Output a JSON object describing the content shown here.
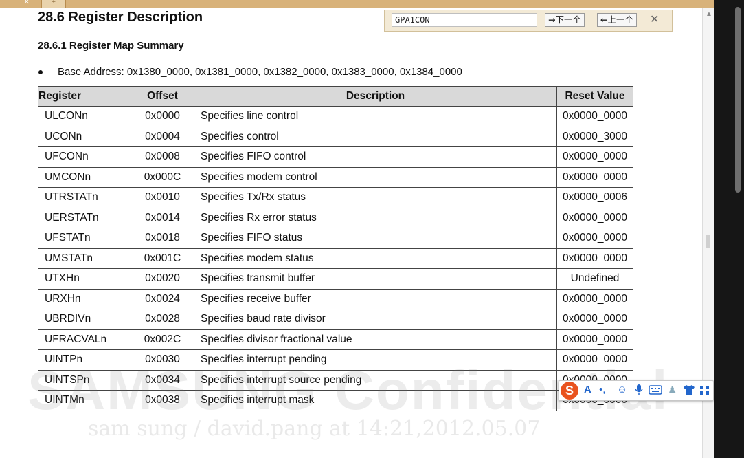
{
  "tabs": {
    "close": "✕",
    "new": "+"
  },
  "heading": "28.6 Register Description",
  "subheading": "28.6.1 Register Map Summary",
  "base_address": "Base Address: 0x1380_0000, 0x1381_0000, 0x1382_0000, 0x1383_0000, 0x1384_0000",
  "table": {
    "headers": [
      "Register",
      "Offset",
      "Description",
      "Reset Value"
    ],
    "rows": [
      [
        "ULCONn",
        "0x0000",
        "Specifies line control",
        "0x0000_0000"
      ],
      [
        "UCONn",
        "0x0004",
        "Specifies control",
        "0x0000_3000"
      ],
      [
        "UFCONn",
        "0x0008",
        "Specifies FIFO control",
        "0x0000_0000"
      ],
      [
        "UMCONn",
        "0x000C",
        "Specifies modem control",
        "0x0000_0000"
      ],
      [
        "UTRSTATn",
        "0x0010",
        "Specifies Tx/Rx status",
        "0x0000_0006"
      ],
      [
        "UERSTATn",
        "0x0014",
        "Specifies Rx error status",
        "0x0000_0000"
      ],
      [
        "UFSTATn",
        "0x0018",
        "Specifies FIFO status",
        "0x0000_0000"
      ],
      [
        "UMSTATn",
        "0x001C",
        "Specifies modem status",
        "0x0000_0000"
      ],
      [
        "UTXHn",
        "0x0020",
        "Specifies transmit buffer",
        "Undefined"
      ],
      [
        "URXHn",
        "0x0024",
        "Specifies receive buffer",
        "0x0000_0000"
      ],
      [
        "UBRDIVn",
        "0x0028",
        "Specifies baud rate divisor",
        "0x0000_0000"
      ],
      [
        "UFRACVALn",
        "0x002C",
        "Specifies divisor fractional value",
        "0x0000_0000"
      ],
      [
        "UINTPn",
        "0x0030",
        "Specifies interrupt pending",
        "0x0000_0000"
      ],
      [
        "UINTSPn",
        "0x0034",
        "Specifies interrupt source pending",
        "0x0000_0000"
      ],
      [
        "UINTMn",
        "0x0038",
        "Specifies interrupt mask",
        "0x0000_0000"
      ]
    ]
  },
  "find_bar": {
    "value": "GPA1CON",
    "next_label": "下一个",
    "prev_label": "上一个",
    "close": "✕"
  },
  "watermark": {
    "main": "SAMSUNG Confidential",
    "sub": "sam sung / david.pang at 14:21,2012.05.07"
  },
  "ime_toolbar": {
    "logo": "S",
    "icons": [
      "letter-a-icon",
      "punctuation-icon",
      "emoji-icon",
      "microphone-icon",
      "keyboard-icon",
      "user-icon",
      "shirt-icon",
      "grid-icon"
    ]
  },
  "colors": {
    "header_bg": "#d9d9d9",
    "findbar_bg": "#f3ead6",
    "tab_strip": "#d8b27a",
    "ime_logo": "#e9531f"
  }
}
